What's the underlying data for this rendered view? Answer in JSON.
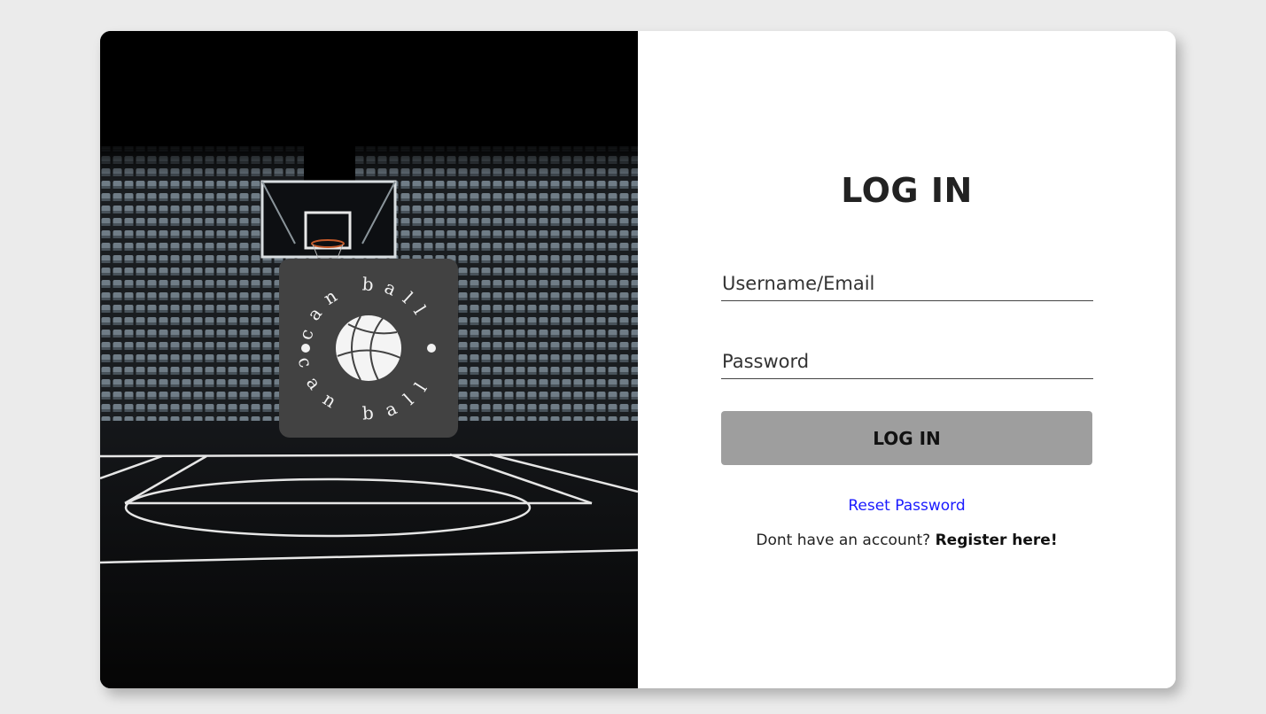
{
  "hero": {
    "logo": {
      "text_top": "can ball",
      "text_bottom": "can ball",
      "icon": "basketball-icon",
      "box_color": "#424242"
    }
  },
  "form": {
    "title": "LOG IN",
    "username_placeholder": "Username/Email",
    "password_placeholder": "Password",
    "login_button_label": "LOG IN",
    "reset_password_label": "Reset Password",
    "register_prompt": "Dont have an account?",
    "register_link_label": "Register here!"
  },
  "colors": {
    "page_background": "#ebebeb",
    "button_background": "#9e9e9e",
    "link": "#1a1aff"
  }
}
